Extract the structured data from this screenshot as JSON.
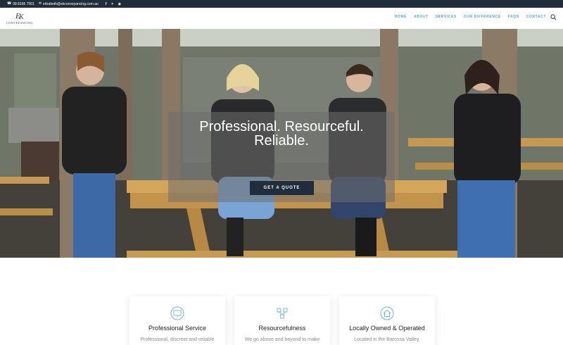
{
  "topbar": {
    "phone": "08 8166 7501",
    "email": "elizabeth@ekconveyancing.com.au",
    "phone_icon": "phone-icon",
    "email_icon": "email-icon",
    "social": [
      "facebook-icon",
      "twitter-icon",
      "instagram-icon"
    ]
  },
  "header": {
    "logo_text": "CONVEYANCING",
    "nav": [
      "HOME",
      "ABOUT",
      "SERVICES",
      "OUR DIFFERENCE",
      "FAQS",
      "CONTACT"
    ],
    "search_icon": "search-icon"
  },
  "hero": {
    "title_line1": "Professional. Resourceful.",
    "title_line2": "Reliable.",
    "cta": "GET A QUOTE"
  },
  "features": [
    {
      "icon": "presentation-icon",
      "title": "Professional Service",
      "text": "Professional, discreet and reliable"
    },
    {
      "icon": "network-icon",
      "title": "Resourcefulness",
      "text": "We go above and beyond to make"
    },
    {
      "icon": "home-icon",
      "title": "Locally Owned & Operated",
      "text": "Located in the Barossa Valley,"
    }
  ],
  "colors": {
    "topbar": "#1f2d3d",
    "nav": "#5aa6c4",
    "accent_icon": "#6cb6d6",
    "cta": "#1f2d3d"
  }
}
